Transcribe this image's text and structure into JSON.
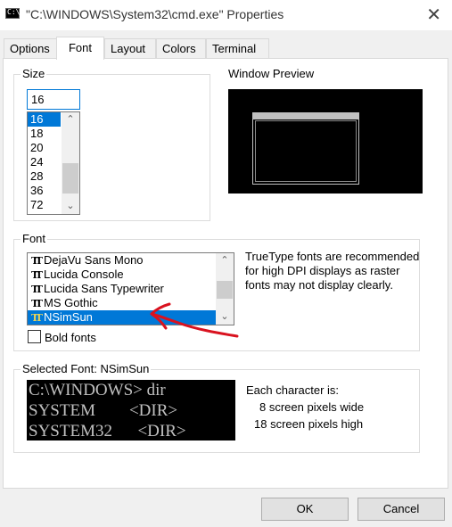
{
  "window": {
    "title": "\"C:\\WINDOWS\\System32\\cmd.exe\" Properties",
    "close_glyph": "✕",
    "icon_text": "C:\\."
  },
  "tabs": [
    {
      "label": "Options",
      "active": false
    },
    {
      "label": "Font",
      "active": true
    },
    {
      "label": "Layout",
      "active": false
    },
    {
      "label": "Colors",
      "active": false
    },
    {
      "label": "Terminal",
      "active": false
    }
  ],
  "size": {
    "group_label": "Size",
    "value": "16",
    "options": [
      "16",
      "18",
      "20",
      "24",
      "28",
      "36",
      "72"
    ],
    "selected": "16"
  },
  "preview": {
    "label": "Window Preview"
  },
  "font": {
    "group_label": "Font",
    "items": [
      "DejaVu Sans Mono",
      "Lucida Console",
      "Lucida Sans Typewriter",
      "MS Gothic",
      "NSimSun"
    ],
    "selected": "NSimSun",
    "truetype_note": "TrueType fonts are recommended for high DPI displays as raster fonts may not display clearly.",
    "bold_label": "Bold fonts",
    "bold_checked": false,
    "tt_glyph": "TT"
  },
  "selected_font": {
    "group_label": "Selected Font: NSimSun",
    "sample_lines": [
      "C:\\WINDOWS> dir",
      "SYSTEM        <DIR>",
      "SYSTEM32      <DIR>"
    ],
    "char_heading": "Each character is:",
    "width_line": "8 screen pixels wide",
    "height_line": "18 screen pixels high"
  },
  "buttons": {
    "ok": "OK",
    "cancel": "Cancel"
  },
  "scroll_glyphs": {
    "up": "⌃",
    "down": "⌄"
  },
  "colors": {
    "accent": "#0078d7",
    "annotation_red": "#d9121f"
  }
}
